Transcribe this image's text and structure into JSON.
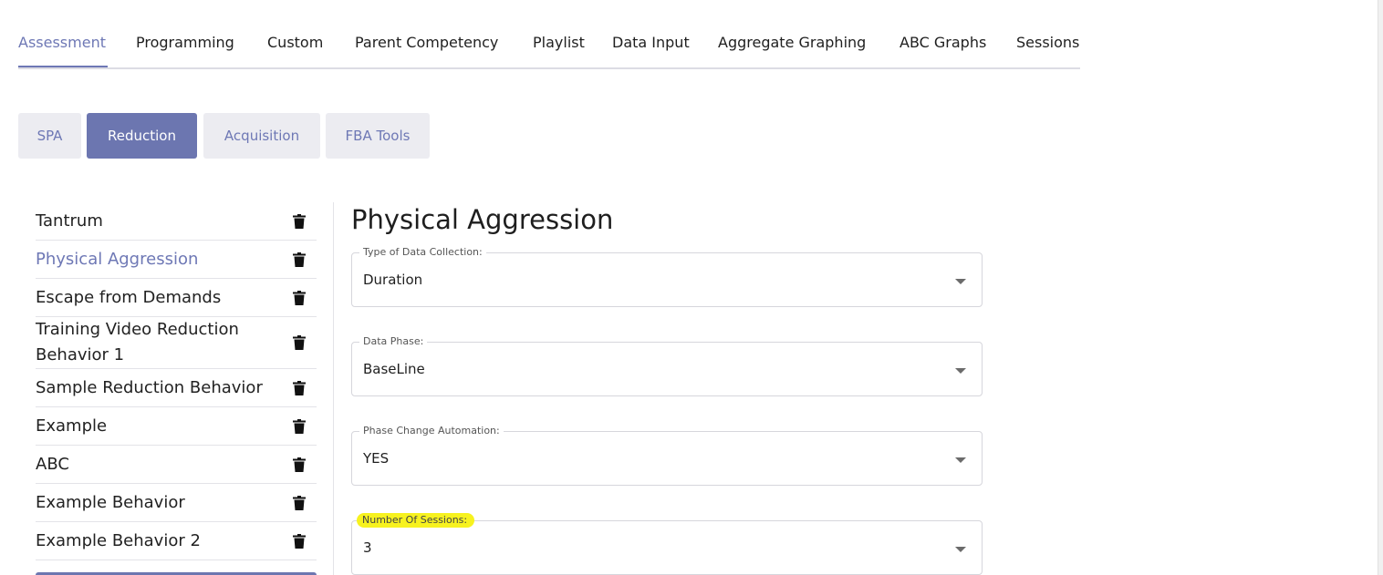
{
  "top_nav": {
    "tabs": [
      {
        "label": "Assessment"
      },
      {
        "label": "Programming"
      },
      {
        "label": "Custom"
      },
      {
        "label": "Parent Competency"
      },
      {
        "label": "Playlist"
      },
      {
        "label": "Data Input"
      },
      {
        "label": "Aggregate Graphing"
      },
      {
        "label": "ABC Graphs"
      },
      {
        "label": "Sessions"
      }
    ],
    "active": "Assessment"
  },
  "sub_tabs": {
    "tabs": [
      {
        "label": "SPA"
      },
      {
        "label": "Reduction"
      },
      {
        "label": "Acquisition"
      },
      {
        "label": "FBA Tools"
      }
    ],
    "active": "Reduction"
  },
  "behaviors": {
    "items": [
      {
        "label": "Tantrum"
      },
      {
        "label": "Physical Aggression"
      },
      {
        "label": "Escape from Demands"
      },
      {
        "label": "Training Video Reduction Behavior 1"
      },
      {
        "label": "Sample Reduction Behavior"
      },
      {
        "label": "Example"
      },
      {
        "label": "ABC"
      },
      {
        "label": "Example Behavior"
      },
      {
        "label": "Example Behavior 2"
      }
    ],
    "active": "Physical Aggression",
    "delete_icon": "trash-icon"
  },
  "detail": {
    "title": "Physical Aggression",
    "fields": [
      {
        "label": "Type of Data Collection:",
        "value": "Duration"
      },
      {
        "label": "Data Phase:",
        "value": "BaseLine"
      },
      {
        "label": "Phase Change Automation:",
        "value": "YES"
      },
      {
        "label": "Number Of Sessions:",
        "value": "3"
      }
    ]
  },
  "colors": {
    "accent": "#6e78b5",
    "highlight": "#f7f21f"
  }
}
